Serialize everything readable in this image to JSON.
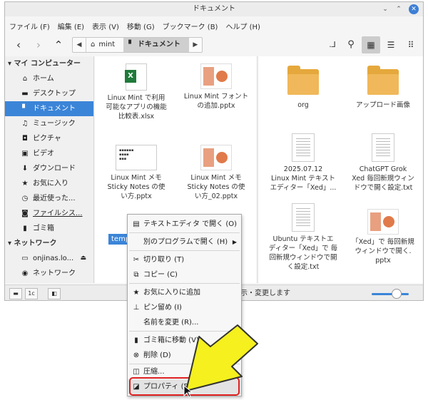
{
  "window": {
    "title": "ドキュメント"
  },
  "menubar": [
    "ファイル (F)",
    "編集 (E)",
    "表示 (V)",
    "移動 (G)",
    "ブックマーク (B)",
    "ヘルプ (H)"
  ],
  "pathbar": {
    "home_label": "mint",
    "current_label": "ドキュメント"
  },
  "sidebar": {
    "computer_header": "マイ コンピューター",
    "computer_items": [
      {
        "label": "ホーム",
        "icon": "home-icon"
      },
      {
        "label": "デスクトップ",
        "icon": "desktop-icon"
      },
      {
        "label": "ドキュメント",
        "icon": "document-icon"
      },
      {
        "label": "ミュージック",
        "icon": "music-icon"
      },
      {
        "label": "ピクチャ",
        "icon": "camera-icon"
      },
      {
        "label": "ビデオ",
        "icon": "video-icon"
      },
      {
        "label": "ダウンロード",
        "icon": "download-icon"
      },
      {
        "label": "お気に入り",
        "icon": "star-icon"
      },
      {
        "label": "最近使った...",
        "icon": "clock-icon"
      },
      {
        "label": "ファイルシス...",
        "icon": "drive-icon"
      },
      {
        "label": "ゴミ箱",
        "icon": "trash-icon"
      }
    ],
    "network_header": "ネットワーク",
    "network_items": [
      {
        "label": "onjinas.lo...",
        "icon": "server-icon"
      },
      {
        "label": "ネットワーク",
        "icon": "network-icon"
      }
    ]
  },
  "files_left": [
    {
      "name": "Linux Mint で利用可能なアプリの機能比較表.xlsx",
      "line1": "Linux Mint で利用",
      "line2": "可能なアプリの機能",
      "line3": "比較表.xlsx",
      "type": "xlsx"
    },
    {
      "name": "Linux Mint フォントの追加.pptx",
      "line1": "Linux Mint フォント",
      "line2": "の追加.pptx",
      "line3": "",
      "type": "pptx"
    },
    {
      "name": "Linux Mint メモ Sticky Notes の使い方.pptx",
      "line1": "Linux Mint メモ",
      "line2": "Sticky Notes の使",
      "line3": "い方.pptx",
      "type": "slide"
    },
    {
      "name": "Linux Mint メモ Sticky Notes の使い方_02.pptx",
      "line1": "Linux Mint メモ",
      "line2": "Sticky Notes の使",
      "line3": "い方_02.pptx",
      "type": "pptx"
    }
  ],
  "selected_label": "templ",
  "files_right": [
    {
      "line1": "org",
      "line2": "",
      "line3": "",
      "type": "folder"
    },
    {
      "line1": "アップロード画像",
      "line2": "",
      "line3": "",
      "type": "folder"
    },
    {
      "line1": "2025.07.12",
      "line2": "Linux Mint テキスト",
      "line3": "エディター「Xed」...",
      "type": "txt"
    },
    {
      "line1": "ChatGPT Grok",
      "line2": "Xed 毎回新規ウィン",
      "line3": "ドウで開く設定.txt",
      "type": "txt"
    },
    {
      "line1": "Ubuntu テキストエ",
      "line2": "ディター「Xed」で 毎",
      "line3": "回新規ウィンドウで開",
      "line4": "く設定.txt",
      "type": "txt"
    },
    {
      "line1": "「Xed」で 毎回新規",
      "line2": "ウィンドウで開く.",
      "line3": "pptx",
      "type": "pptx"
    }
  ],
  "statusbar": {
    "text": "示・変更します"
  },
  "context_menu": [
    {
      "label": "テキストエディタ で開く (O)",
      "icon": "text-editor-icon"
    },
    {
      "label": "別のプログラムで開く (H)",
      "icon": "",
      "submenu": "▶"
    },
    {
      "label": "切り取り (T)",
      "icon": "cut-icon"
    },
    {
      "label": "コピー (C)",
      "icon": "copy-icon"
    },
    {
      "label": "お気に入りに追加",
      "icon": "star-icon"
    },
    {
      "label": "ピン留め (I)",
      "icon": "pin-icon"
    },
    {
      "label": "名前を変更 (R)...",
      "icon": ""
    },
    {
      "label": "ゴミ箱に移動 (V)",
      "icon": "trash-icon"
    },
    {
      "label": "削除 (D)",
      "icon": "delete-icon"
    },
    {
      "label": "圧縮...",
      "icon": "archive-icon"
    },
    {
      "label": "プロパティ (P)",
      "icon": "properties-icon"
    }
  ],
  "colors": {
    "accent": "#3b85d8",
    "highlight": "#e02020",
    "arrow_fill": "#f5f01e"
  }
}
